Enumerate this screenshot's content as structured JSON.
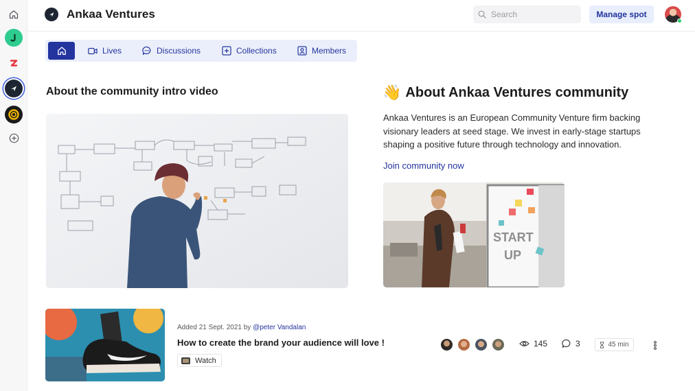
{
  "header": {
    "title": "Ankaa Ventures",
    "search_placeholder": "Search",
    "manage_label": "Manage spot"
  },
  "rail": {
    "icons": [
      "home-icon",
      "app-j-icon",
      "app-z-icon",
      "ankaa-icon",
      "app-ring-icon",
      "add-icon"
    ]
  },
  "tabs": [
    {
      "label": "",
      "icon": "home-icon",
      "active": true
    },
    {
      "label": "Lives",
      "icon": "video-camera-icon"
    },
    {
      "label": "Discussions",
      "icon": "chat-bubble-icon"
    },
    {
      "label": "Collections",
      "icon": "collection-plus-icon"
    },
    {
      "label": "Members",
      "icon": "member-badge-icon"
    }
  ],
  "intro": {
    "heading": "About the community intro video"
  },
  "about": {
    "emoji": "👋",
    "heading": "About Ankaa Ventures community",
    "text": "Ankaa Ventures is an European Community Venture firm backing visionary leaders at seed stage. We invest in early-stage startups shaping a positive future through technology and innovation.",
    "join_label": "Join community now"
  },
  "content_row": {
    "meta_prefix": "Added 21 Sept. 2021 by",
    "author": "@peter Vandalan",
    "title": "How to create the brand your audience will love !",
    "watch_label": "Watch",
    "views": "145",
    "comments": "3",
    "duration": "45 min"
  },
  "colors": {
    "accent": "#23349e",
    "tab_bg": "#ebeffb",
    "rail_bg": "#f7f7f8",
    "online": "#2ecc71"
  }
}
